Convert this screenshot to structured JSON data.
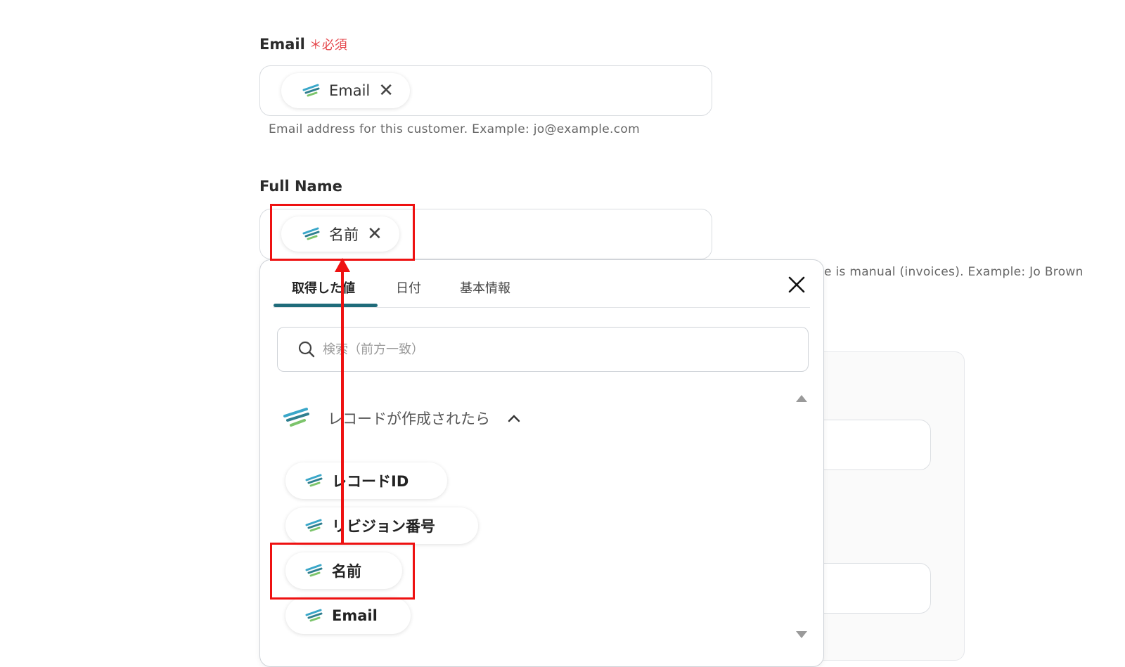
{
  "email_field": {
    "label": "Email",
    "required_mark": "＊必須",
    "chip_label": "Email",
    "help": "Email address for this customer. Example: jo@example.com"
  },
  "fullname_field": {
    "label": "Full Name",
    "chip_label": "名前",
    "help_partial": "e is manual (invoices). Example: Jo Brown"
  },
  "picker": {
    "tabs": [
      "取得した値",
      "日付",
      "基本情報"
    ],
    "active_tab": 0,
    "search_placeholder": "検索（前方一致）",
    "section_title": "レコードが作成されたら",
    "items": [
      "レコードID",
      "リビジョン番号",
      "名前",
      "Email"
    ]
  },
  "colors": {
    "accent": "#1f6b7a",
    "highlight": "#e11111",
    "required": "#e5484d"
  },
  "icons": {
    "chip_icon": "yoom-wing-icon",
    "close": "close-icon",
    "search": "search-icon",
    "collapse": "chevron-up-icon"
  }
}
